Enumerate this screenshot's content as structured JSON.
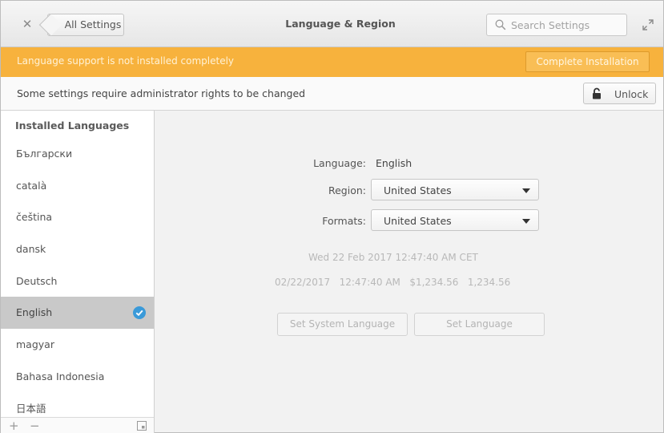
{
  "window": {
    "title": "Language & Region",
    "back_label": "All Settings",
    "search_placeholder": "Search Settings"
  },
  "infobar": {
    "message": "Language support is not installed completely",
    "button_label": "Complete Installation",
    "color": "#f7b23d"
  },
  "permission": {
    "message": "Some settings require administrator rights to be changed",
    "unlock_label": "Unlock"
  },
  "sidebar": {
    "header": "Installed Languages",
    "items": [
      {
        "label": "Български"
      },
      {
        "label": "català"
      },
      {
        "label": "čeština"
      },
      {
        "label": "dansk"
      },
      {
        "label": "Deutsch"
      },
      {
        "label": "English",
        "selected": true
      },
      {
        "label": "magyar"
      },
      {
        "label": "Bahasa Indonesia"
      },
      {
        "label": "日本語"
      }
    ],
    "footer": {
      "add_icon": "plus-icon",
      "remove_icon": "minus-icon",
      "keyboard_icon": "keyboard-settings-icon"
    }
  },
  "main": {
    "language_label": "Language:",
    "language_value": "English",
    "region_label": "Region:",
    "region_value": "United States",
    "formats_label": "Formats:",
    "formats_value": "United States",
    "date_preview": "Wed 22 Feb 2017 12:47:40 AM CET",
    "format_preview": "02/22/2017   12:47:40 AM   $1,234.56   1,234.56",
    "set_system_language_label": "Set System Language",
    "set_language_label": "Set Language"
  },
  "colors": {
    "accent_check": "#3a9ad9",
    "selection": "#c9c9c9"
  }
}
